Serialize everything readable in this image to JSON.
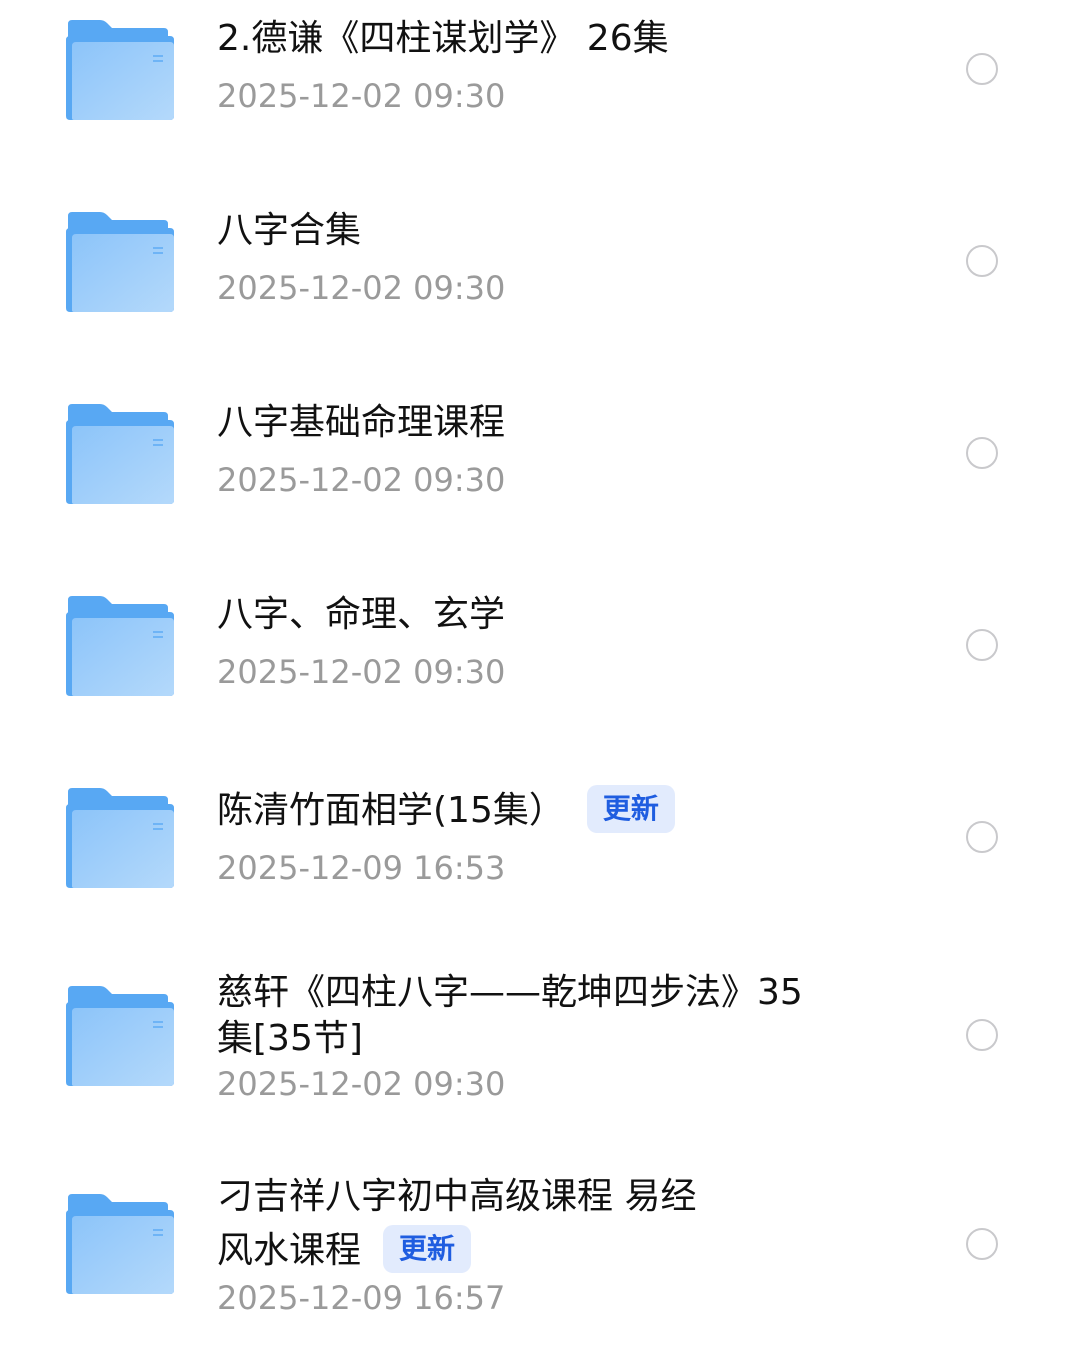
{
  "colors": {
    "folder_back": "#58A8F3",
    "folder_front_top": "#8CC4F9",
    "folder_front_bottom": "#B4D9FB",
    "badge_text": "#1F5DE0",
    "badge_bg": "#E2EBFD",
    "date_text": "#9A9A9A",
    "radio_border": "#C9C9CC"
  },
  "items": [
    {
      "title": "2.德谦《四柱谋划学》 26集",
      "date": "2025-12-02 09:30",
      "icon": "folder-icon"
    },
    {
      "title": "八字合集",
      "date": "2025-12-02 09:30",
      "icon": "folder-icon"
    },
    {
      "title": "八字基础命理课程",
      "date": "2025-12-02 09:30",
      "icon": "folder-icon"
    },
    {
      "title": "八字、命理、玄学",
      "date": "2025-12-02 09:30",
      "icon": "folder-icon"
    },
    {
      "title": "陈清竹面相学(15集）",
      "badge": "更新",
      "date": "2025-12-09 16:53",
      "icon": "folder-icon"
    },
    {
      "title_line1": "慈轩《四柱八字——乾坤四步法》35",
      "title_line2": "集[35节]",
      "date": "2025-12-02 09:30",
      "icon": "folder-icon"
    },
    {
      "title_line1": "刁吉祥八字初中高级课程 易经",
      "title_line2": "风水课程",
      "badge": "更新",
      "date": "2025-12-09 16:57",
      "icon": "folder-icon"
    }
  ]
}
